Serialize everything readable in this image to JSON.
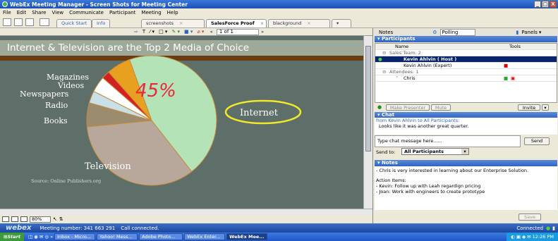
{
  "window": {
    "title": "WebEx Meeting Manager - Screen Shots for Meeting Center",
    "buttons": [
      "_",
      "□",
      "X"
    ]
  },
  "menu": [
    "File",
    "Edit",
    "Share",
    "View",
    "Communicate",
    "Participant",
    "Meeting",
    "Help"
  ],
  "tabs": [
    {
      "label": "Quick Start"
    },
    {
      "label": "Info"
    },
    {
      "label": "screenshots"
    },
    {
      "label": "SalesForce Proof"
    },
    {
      "label": "blackground"
    }
  ],
  "page": {
    "current": "1 of 1"
  },
  "slide": {
    "title": "Internet & Television are the Top 2 Media of Choice",
    "source": "Source: Online Publishers.org",
    "annotation": "45%",
    "chart_data": {
      "type": "pie",
      "title": "Internet & Television are the Top 2 Media of Choice",
      "categories": [
        "Internet",
        "Television",
        "Books",
        "Radio",
        "Newspapers",
        "Videos",
        "Magazines"
      ],
      "values": [
        45,
        34,
        6,
        3,
        4,
        2,
        6
      ],
      "colors": [
        "#b4e3b8",
        "#b8a89c",
        "#9c8c6e",
        "#c8e0e8",
        "#ffffff",
        "#d42020",
        "#e8a020"
      ]
    }
  },
  "zoom": "80%",
  "right": {
    "tabs": {
      "notes": "Notes",
      "polling": "Polling",
      "panels": "Panels"
    },
    "participants": {
      "header": "Participants",
      "columns": [
        "Name",
        "Tools"
      ],
      "groups": [
        {
          "label": "Sales Team: 2",
          "members": [
            "Kevin Ahlvin ( Host )",
            "Kevin Ahlvin  (Expert)"
          ]
        },
        {
          "label": "Attendees: 1",
          "members": [
            "Chris"
          ]
        }
      ],
      "buttons": {
        "presenter": "Make Presenter",
        "mute": "Mute",
        "invite": "Invite"
      }
    },
    "chat": {
      "header": "Chat",
      "from": "from Kevin Ahlvin to All Participants:",
      "message": "Looks like it was another great quarter.",
      "input_placeholder": "Type chat message here......",
      "send": "Send",
      "send_to_label": "Send to:",
      "send_to_value": "All Participants"
    },
    "notes": {
      "header": "Notes",
      "lines": [
        "- Chris is very interested in learning about our Enterprise Solution.",
        "",
        "Action Items:",
        "- Kevin: Follow up with Leah regardign pricing",
        "- Joan: Work with engineers to create prototype"
      ],
      "save": "Save"
    }
  },
  "status": {
    "logo": "webex",
    "meeting": "Meeting number: 341 663 291",
    "connection": "Call connected.",
    "connected": "Connected"
  },
  "taskbar": {
    "start": "Start",
    "items": [
      "Inbox - Micro...",
      "Yahoo! Mess...",
      "Adobe Photo...",
      "WebEx Enter...",
      "WebEx Mee..."
    ],
    "time": "12:26 PM"
  },
  "colors": {
    "accent": "#2f64c2",
    "slide_bg": "#5e6e69",
    "highlight": "#0a246a",
    "annotation": "#e8283c"
  }
}
